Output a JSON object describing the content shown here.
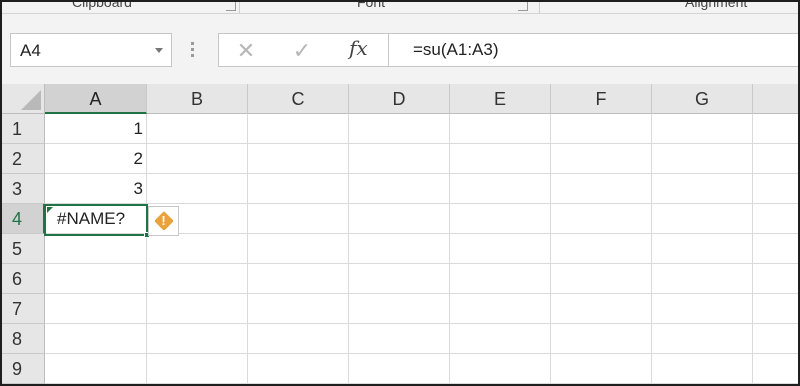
{
  "ribbon": {
    "groups": [
      {
        "label": "Clipboard"
      },
      {
        "label": "Font"
      },
      {
        "label": "Alignment"
      }
    ]
  },
  "formula_bar": {
    "name_box": "A4",
    "cancel_glyph": "✕",
    "enter_glyph": "✓",
    "insert_function_glyph": "fx",
    "formula": "=su(A1:A3)"
  },
  "sheet": {
    "columns": [
      "A",
      "B",
      "C",
      "D",
      "E",
      "F",
      "G"
    ],
    "rows": [
      "1",
      "2",
      "3",
      "4",
      "5",
      "6",
      "7",
      "8",
      "9"
    ],
    "selected_cell": "A4",
    "cells": {
      "A1": "1",
      "A2": "2",
      "A3": "3",
      "A4": "#NAME?"
    }
  },
  "error_indicator": {
    "icon": "warning-diamond-icon",
    "glyph": "!"
  },
  "colors": {
    "accent": "#217346",
    "warning": "#e8a33a",
    "header_bg": "#e6e6e6",
    "selected_header_bg": "#d2d2d2"
  }
}
